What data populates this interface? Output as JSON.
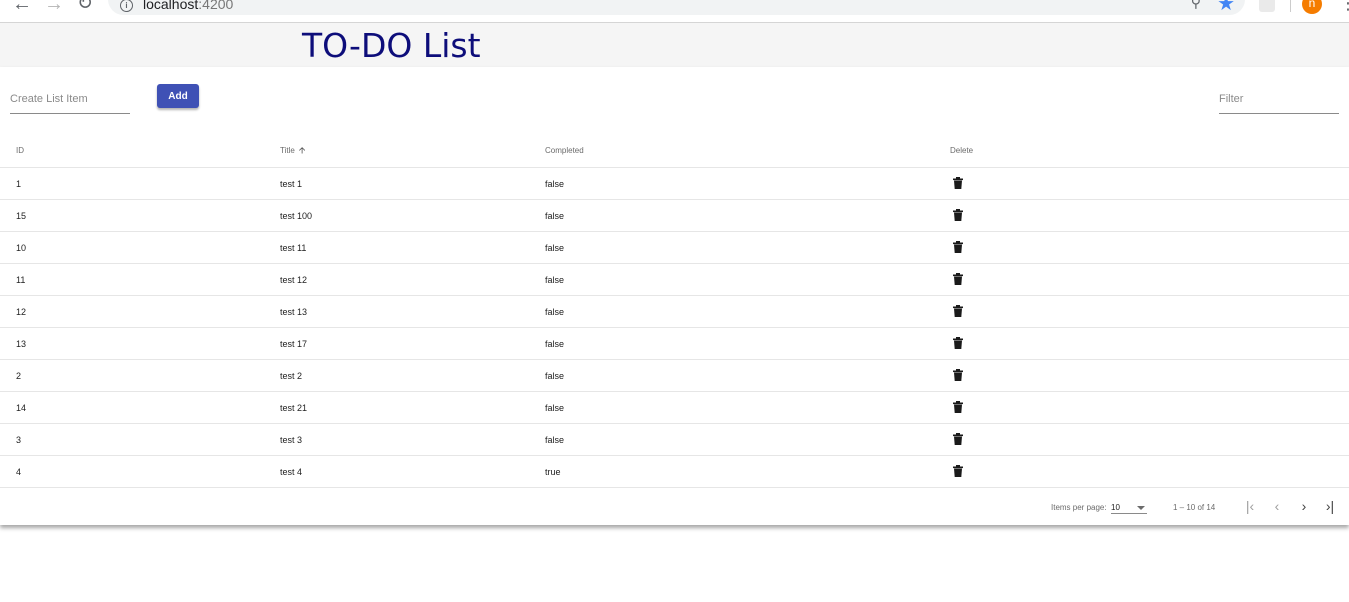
{
  "browser": {
    "url_host": "localhost",
    "url_port": ":4200",
    "profile_initial": "n"
  },
  "header": {
    "title": "TO-DO List"
  },
  "toolbar": {
    "create_placeholder": "Create List Item",
    "add_label": "Add",
    "filter_placeholder": "Filter"
  },
  "table": {
    "columns": {
      "id": "ID",
      "title": "Title",
      "completed": "Completed",
      "delete": "Delete"
    },
    "sort_column": "Title",
    "rows": [
      {
        "id": "1",
        "title": "test 1",
        "completed": "false"
      },
      {
        "id": "15",
        "title": "test 100",
        "completed": "false"
      },
      {
        "id": "10",
        "title": "test 11",
        "completed": "false"
      },
      {
        "id": "11",
        "title": "test 12",
        "completed": "false"
      },
      {
        "id": "12",
        "title": "test 13",
        "completed": "false"
      },
      {
        "id": "13",
        "title": "test 17",
        "completed": "false"
      },
      {
        "id": "2",
        "title": "test 2",
        "completed": "false"
      },
      {
        "id": "14",
        "title": "test 21",
        "completed": "false"
      },
      {
        "id": "3",
        "title": "test 3",
        "completed": "false"
      },
      {
        "id": "4",
        "title": "test 4",
        "completed": "true"
      }
    ]
  },
  "paginator": {
    "items_per_page_label": "Items per page:",
    "page_size": "10",
    "range_label": "1 – 10 of 14"
  },
  "colors": {
    "primary": "#3f51b5",
    "title": "#0d0d7a",
    "profile": "#f57c00"
  }
}
